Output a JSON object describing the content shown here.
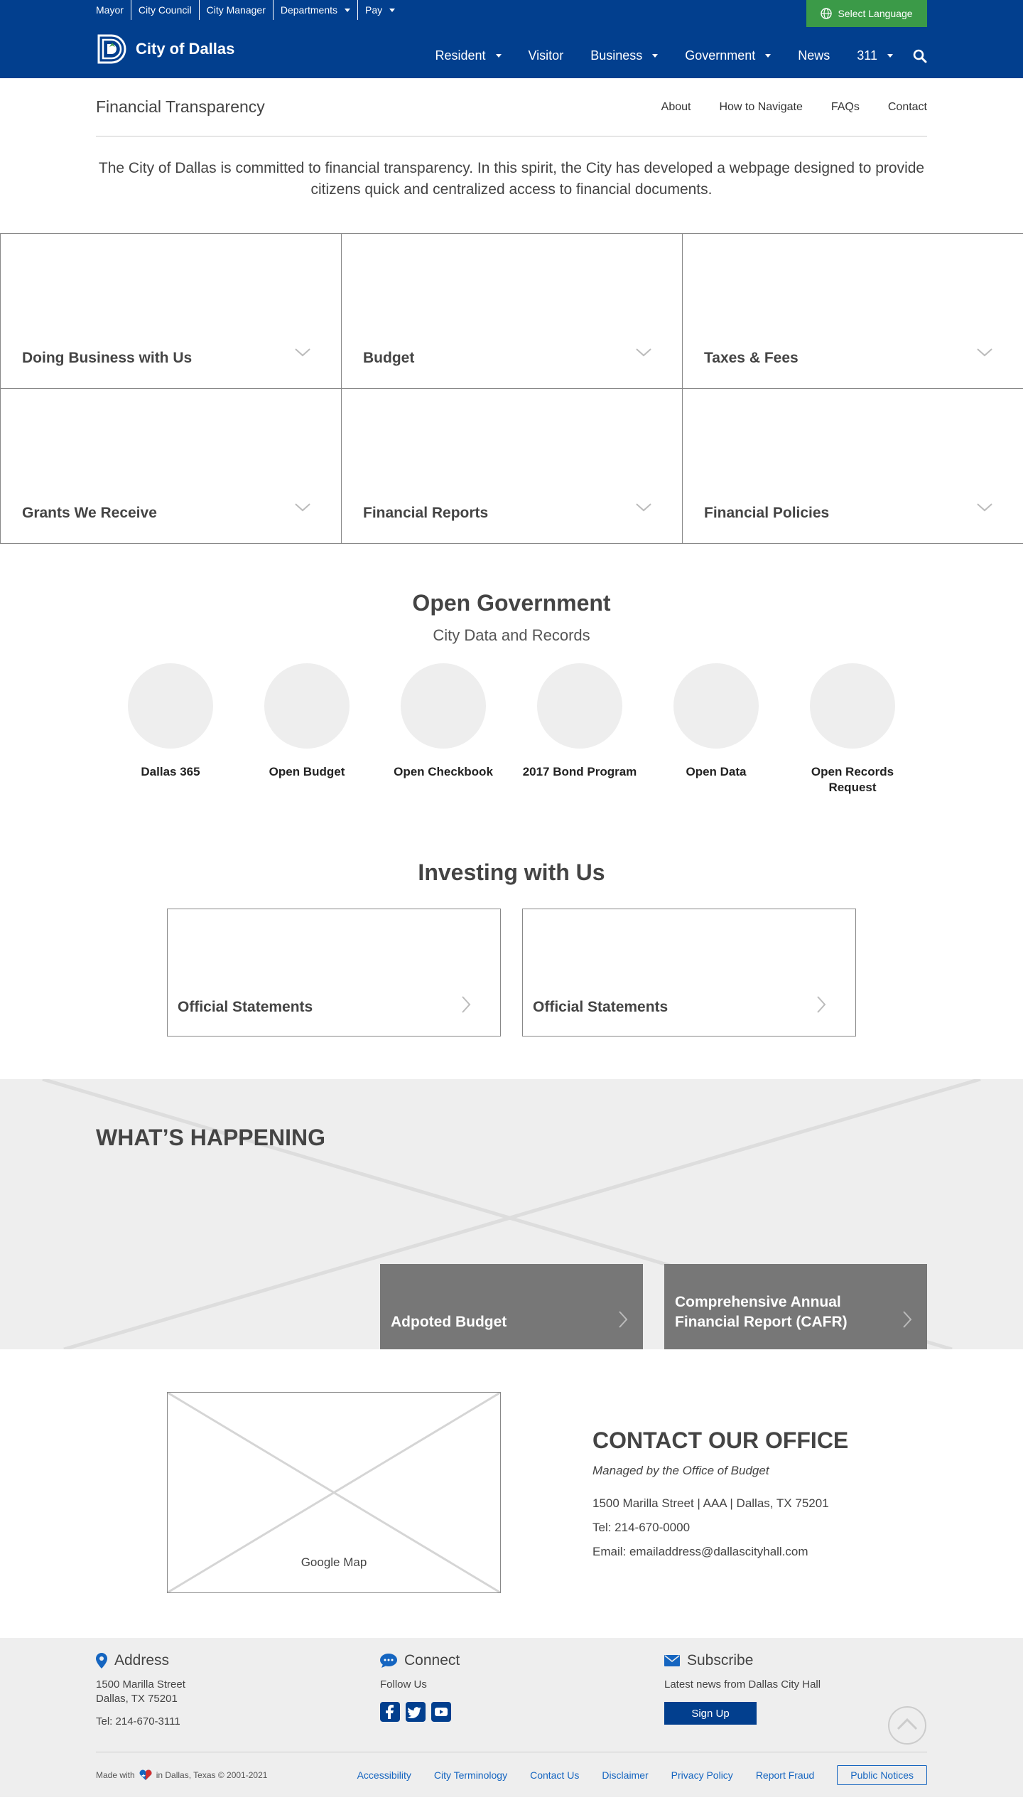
{
  "header": {
    "top_links": [
      {
        "label": "Mayor",
        "dropdown": false
      },
      {
        "label": "City Council",
        "dropdown": false
      },
      {
        "label": "City Manager",
        "dropdown": false
      },
      {
        "label": "Departments",
        "dropdown": true
      },
      {
        "label": "Pay",
        "dropdown": true
      }
    ],
    "language_label": "Select Language",
    "logo_title": "City of Dallas",
    "nav": [
      {
        "label": "Resident",
        "dropdown": true
      },
      {
        "label": "Visitor",
        "dropdown": false
      },
      {
        "label": "Business",
        "dropdown": true
      },
      {
        "label": "Government",
        "dropdown": true
      },
      {
        "label": "News",
        "dropdown": false
      },
      {
        "label": "311",
        "dropdown": true
      }
    ]
  },
  "subheader": {
    "title": "Financial Transparency",
    "links": [
      "About",
      "How to Navigate",
      "FAQs",
      "Contact"
    ]
  },
  "intro": "The City of Dallas is committed to financial transparency. In this spirit, the City has developed a webpage designed to provide citizens quick and centralized access to financial documents.",
  "tiles": [
    "Doing Business with Us",
    "Budget",
    "Taxes & Fees",
    "Grants We Receive",
    "Financial Reports",
    "Financial Policies"
  ],
  "open_government": {
    "title": "Open Government",
    "subtitle": "City Data and Records",
    "items": [
      "Dallas 365",
      "Open Budget",
      "Open Checkbook",
      "2017 Bond Program",
      "Open Data",
      "Open Records Request"
    ]
  },
  "investing": {
    "title": "Investing with Us",
    "cards": [
      "Official Statements",
      "Official Statements"
    ]
  },
  "happening": {
    "title": "WHAT’S HAPPENING",
    "cards": [
      "Adpoted Budget",
      "Comprehensive Annual Financial Report (CAFR)"
    ]
  },
  "contact": {
    "map_label": "Google Map",
    "title": "CONTACT OUR OFFICE",
    "subtitle": "Managed by the Office of Budget",
    "address": "1500 Marilla Street | AAA | Dallas, TX 75201",
    "tel": "Tel:  214-670-0000",
    "email": "Email: emailaddress@dallascityhall.com"
  },
  "footer": {
    "address": {
      "title": "Address",
      "line1": "1500 Marilla Street",
      "line2": "Dallas, TX 75201",
      "tel": "Tel: 214-670-3111"
    },
    "connect": {
      "title": "Connect",
      "text": "Follow Us"
    },
    "subscribe": {
      "title": "Subscribe",
      "text": "Latest news from Dallas City Hall",
      "button": "Sign Up"
    },
    "made_with": "Made with",
    "made_in": "in Dallas, Texas © 2001-2021",
    "links": [
      "Accessibility",
      "City Terminology",
      "Contact Us",
      "Disclaimer",
      "Privacy Policy",
      "Report Fraud"
    ],
    "public_notices": "Public Notices"
  },
  "colors": {
    "header_blue": "#023F8E",
    "language_green": "#3B9A48",
    "link_blue": "#1565C0",
    "tile_border": "#888888",
    "card_grey": "#777777"
  }
}
